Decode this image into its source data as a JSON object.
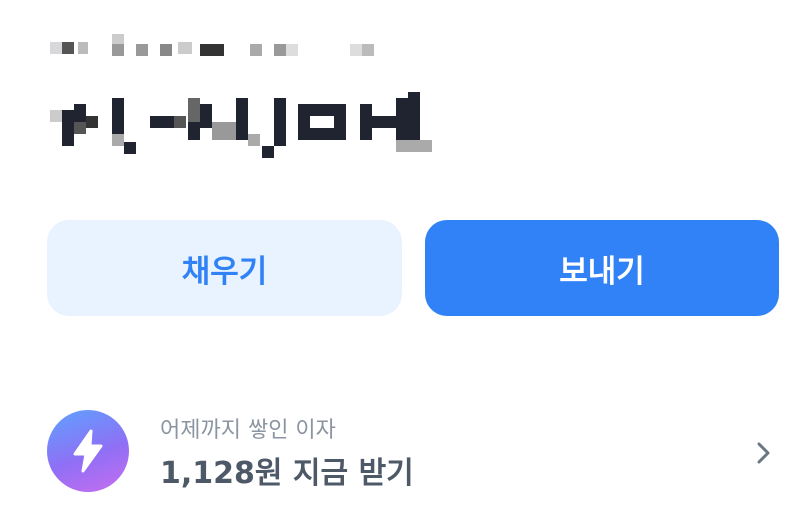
{
  "account": {
    "redacted_subtitle": "",
    "redacted_balance": ""
  },
  "actions": {
    "fill_label": "채우기",
    "send_label": "보내기"
  },
  "interest": {
    "subtitle": "어제까지 쌓인 이자",
    "main": "1,128원 지금 받기",
    "icon": "lightning-bolt-icon",
    "chevron_icon": "chevron-right-icon"
  },
  "colors": {
    "primary": "#3182f6",
    "primary_light": "#e8f3ff",
    "text_sub": "#8b95a1",
    "text_main": "#4e5968"
  }
}
